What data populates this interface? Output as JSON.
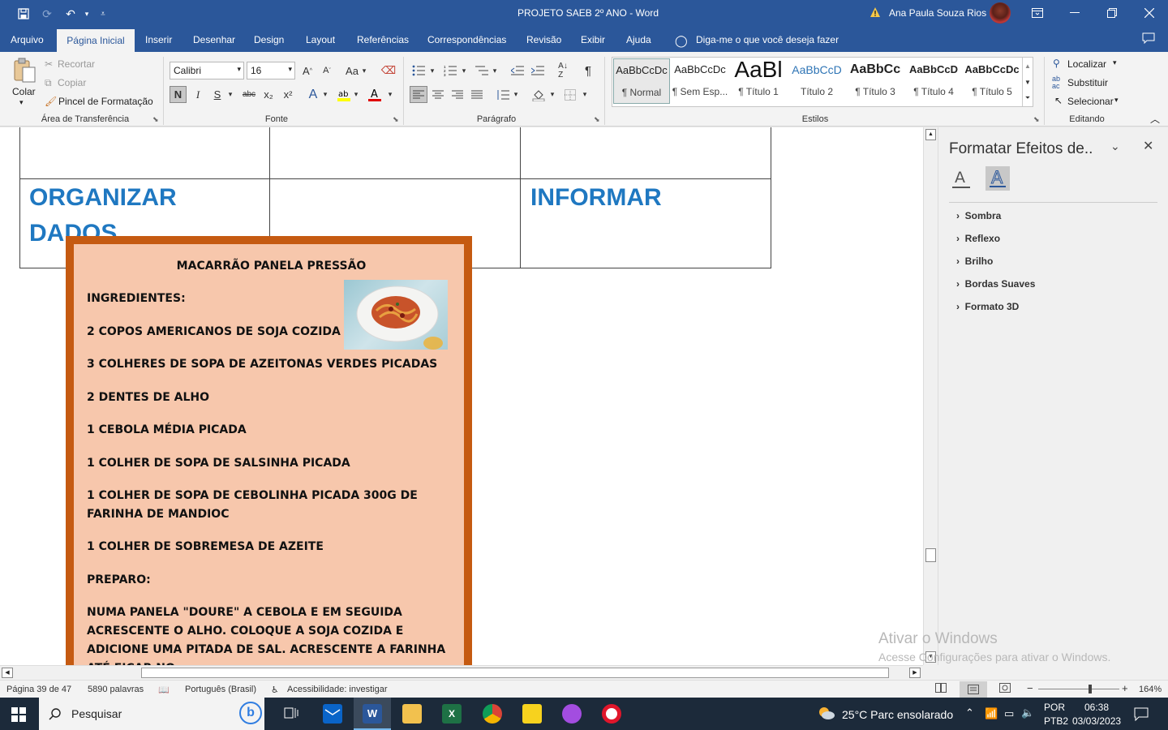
{
  "titlebar": {
    "doc_title": "PROJETO SAEB 2º ANO  -  Word",
    "user_name": "Ana Paula Souza Rios",
    "icons": [
      "save-icon",
      "redo-icon",
      "undo-icon",
      "customize-icon"
    ]
  },
  "tabs": [
    "Arquivo",
    "Página Inicial",
    "Inserir",
    "Desenhar",
    "Design",
    "Layout",
    "Referências",
    "Correspondências",
    "Revisão",
    "Exibir",
    "Ajuda"
  ],
  "tellme": "Diga-me o que você deseja fazer",
  "ribbon": {
    "clipboard": {
      "paste": "Colar",
      "cut": "Recortar",
      "copy": "Copiar",
      "format_painter": "Pincel de Formatação",
      "group": "Área de Transferência"
    },
    "font": {
      "name": "Calibri",
      "size": "16",
      "change_case": "Aa",
      "group": "Fonte",
      "bold": "N",
      "italic": "I",
      "underline": "S",
      "strike": "abc",
      "sub": "x₂",
      "sup": "x²"
    },
    "paragraph": {
      "group": "Parágrafo"
    },
    "styles": {
      "group": "Estilos",
      "items": [
        {
          "preview": "AaBbCcDc",
          "name": "¶ Normal"
        },
        {
          "preview": "AaBbCcDc",
          "name": "¶ Sem Esp..."
        },
        {
          "preview": "AaBl",
          "name": "¶ Título 1"
        },
        {
          "preview": "AaBbCcD",
          "name": "Título 2"
        },
        {
          "preview": "AaBbCc",
          "name": "¶ Título 3"
        },
        {
          "preview": "AaBbCcD",
          "name": "¶ Título 4"
        },
        {
          "preview": "AaBbCcDc",
          "name": "¶ Título 5"
        }
      ]
    },
    "editing": {
      "find": "Localizar",
      "replace": "Substituir",
      "select": "Selecionar",
      "group": "Editando"
    }
  },
  "document": {
    "cell_left": "ORGANIZAR DADOS",
    "cell_left_line1": "ORGANIZAR",
    "cell_left_line2": "DADOS",
    "cell_right": "INFORMAR",
    "recipe": {
      "title": "MACARRÃO PANELA PRESSÃO",
      "lines": [
        "INGREDIENTES:",
        "2 COPOS AMERICANOS DE SOJA COZIDA",
        "3 COLHERES DE SOPA DE AZEITONAS VERDES PICADAS",
        "2 DENTES DE ALHO",
        "1 CEBOLA MÉDIA PICADA",
        "1 COLHER DE SOPA DE SALSINHA PICADA",
        "1 COLHER DE SOPA DE CEBOLINHA PICADA 300G DE FARINHA DE MANDIOC",
        "1 COLHER DE SOBREMESA DE AZEITE",
        "PREPARO:",
        "NUMA PANELA \"DOURE\" A CEBOLA E EM SEGUIDA ACRESCENTE O ALHO. COLOQUE A SOJA COZIDA E ADICIONE UMA PITADA DE SAL. ACRESCENTE A FARINHA ATÉ FICAR NO"
      ]
    }
  },
  "pane": {
    "title": "Formatar Efeitos de..",
    "sections": [
      "Sombra",
      "Reflexo",
      "Brilho",
      "Bordas Suaves",
      "Formato 3D"
    ]
  },
  "watermark": {
    "line1": "Ativar o Windows",
    "line2": "Acesse Configurações para ativar o Windows."
  },
  "status": {
    "page": "Página 39 de 47",
    "words": "5890 palavras",
    "language": "Português (Brasil)",
    "accessibility": "Acessibilidade: investigar",
    "zoom": "164%",
    "zoom_level": 0.64
  },
  "taskbar": {
    "search": "Pesquisar",
    "weather": "25°C  Parc ensolarado",
    "lang1": "POR",
    "lang2": "PTB2",
    "time": "06:38",
    "date": "03/03/2023"
  },
  "colors": {
    "word_blue": "#2b579a",
    "heading_blue": "#1f78c1",
    "recipe_bg": "#f7c7ac",
    "recipe_border": "#c55a11"
  }
}
